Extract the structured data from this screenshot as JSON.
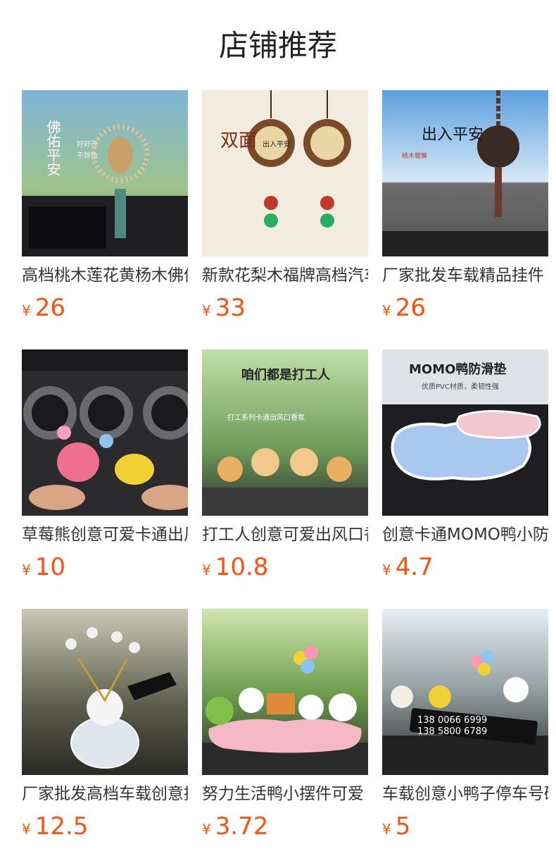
{
  "page_title": "店铺推荐",
  "currency_symbol": "¥",
  "products": [
    {
      "name": "高档桃木莲花黄杨木佛像汽车挂件",
      "price": "26",
      "image_text": [
        "佛佑平安",
        "好好开",
        "不辞色"
      ]
    },
    {
      "name": "新款花梨木福牌高档汽车挂件",
      "price": "33",
      "image_text": [
        "双面",
        "出入平安"
      ]
    },
    {
      "name": "厂家批发车载精品挂件",
      "price": "26",
      "image_text": [
        "出入平安",
        "桃木貔貅"
      ]
    },
    {
      "name": "草莓熊创意可爱卡通出风口香薰",
      "price": "10",
      "image_text": []
    },
    {
      "name": "打工人创意可爱出风口香薰",
      "price": "10.8",
      "image_text": [
        "咱们都是打工人",
        "打工系列卡通出风口香氛"
      ]
    },
    {
      "name": "创意卡通MOMO鸭小防滑垫",
      "price": "4.7",
      "image_text": [
        "MOMO鸭防滑垫",
        "优质PVC材质，柔韧性强"
      ]
    },
    {
      "name": "厂家批发高档车载创意摆件",
      "price": "12.5",
      "image_text": []
    },
    {
      "name": "努力生活鸭小摆件可爱",
      "price": "3.72",
      "image_text": []
    },
    {
      "name": "车载创意小鸭子停车号码牌",
      "price": "5",
      "image_text": [
        "138 0066 6999",
        "138 5800 6789"
      ]
    }
  ],
  "colors": {
    "price": "#ff4f0f",
    "title": "#222222",
    "name": "#333333"
  }
}
